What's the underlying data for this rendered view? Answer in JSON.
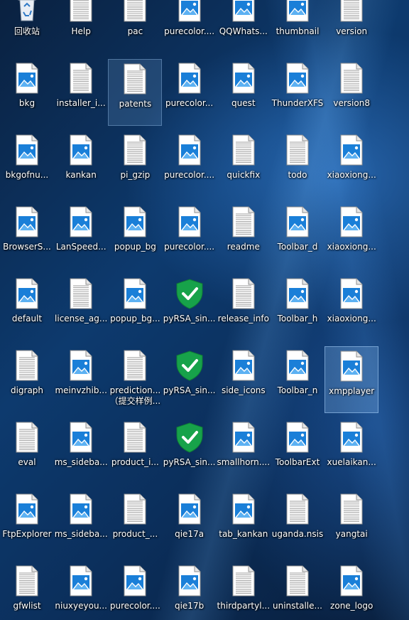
{
  "desktop": {
    "icons": [
      {
        "label": "回收站",
        "type": "recycle-bin"
      },
      {
        "label": "Help",
        "type": "document"
      },
      {
        "label": "pac",
        "type": "document"
      },
      {
        "label": "purecolor....",
        "type": "image"
      },
      {
        "label": "QQWhats...",
        "type": "image"
      },
      {
        "label": "thumbnail",
        "type": "image"
      },
      {
        "label": "version",
        "type": "document"
      },
      {
        "label": "bkg",
        "type": "image"
      },
      {
        "label": "installer_i...",
        "type": "document"
      },
      {
        "label": "patents",
        "type": "document",
        "state": "hovered"
      },
      {
        "label": "purecolor...",
        "type": "image"
      },
      {
        "label": "quest",
        "type": "image"
      },
      {
        "label": "ThunderXFS",
        "type": "image"
      },
      {
        "label": "version8",
        "type": "document"
      },
      {
        "label": "bkgofnu...",
        "type": "image"
      },
      {
        "label": "kankan",
        "type": "image"
      },
      {
        "label": "pi_gzip",
        "type": "document"
      },
      {
        "label": "purecolor....",
        "type": "image"
      },
      {
        "label": "quickfix",
        "type": "document"
      },
      {
        "label": "todo",
        "type": "document"
      },
      {
        "label": "xiaoxiong...",
        "type": "image"
      },
      {
        "label": "BrowserS...",
        "type": "image"
      },
      {
        "label": "LanSpeed...",
        "type": "image"
      },
      {
        "label": "popup_bg",
        "type": "image"
      },
      {
        "label": "purecolor....",
        "type": "image"
      },
      {
        "label": "readme",
        "type": "document"
      },
      {
        "label": "Toolbar_d",
        "type": "image"
      },
      {
        "label": "xiaoxiong...",
        "type": "image"
      },
      {
        "label": "default",
        "type": "image"
      },
      {
        "label": "license_ag...",
        "type": "document"
      },
      {
        "label": "popup_bg...",
        "type": "image"
      },
      {
        "label": "pyRSA_sin...",
        "type": "shield"
      },
      {
        "label": "release_info",
        "type": "document"
      },
      {
        "label": "Toolbar_h",
        "type": "image"
      },
      {
        "label": "xiaoxiong...",
        "type": "image"
      },
      {
        "label": "digraph",
        "type": "document"
      },
      {
        "label": "meinvzhib...",
        "type": "image"
      },
      {
        "label": "prediction...\n（提交样例...",
        "type": "document"
      },
      {
        "label": "pyRSA_sin...",
        "type": "shield"
      },
      {
        "label": "side_icons",
        "type": "image"
      },
      {
        "label": "Toolbar_n",
        "type": "image"
      },
      {
        "label": "xmpplayer",
        "type": "image",
        "state": "selected"
      },
      {
        "label": "eval",
        "type": "document"
      },
      {
        "label": "ms_sideba...",
        "type": "image"
      },
      {
        "label": "product_i...",
        "type": "document"
      },
      {
        "label": "pyRSA_sin...",
        "type": "shield"
      },
      {
        "label": "smallhorn....",
        "type": "image"
      },
      {
        "label": "ToolbarExt",
        "type": "image"
      },
      {
        "label": "xuelaikan...",
        "type": "image"
      },
      {
        "label": "FtpExplorer",
        "type": "image"
      },
      {
        "label": "ms_sideba...",
        "type": "image"
      },
      {
        "label": "product_...",
        "type": "document"
      },
      {
        "label": "qie17a",
        "type": "image"
      },
      {
        "label": "tab_kankan",
        "type": "image"
      },
      {
        "label": "uganda.nsis",
        "type": "document"
      },
      {
        "label": "yangtai",
        "type": "document"
      },
      {
        "label": "gfwlist",
        "type": "document"
      },
      {
        "label": "niuxyeyou...",
        "type": "image"
      },
      {
        "label": "purecolor....",
        "type": "image"
      },
      {
        "label": "qie17b",
        "type": "image"
      },
      {
        "label": "thirdpartyl...",
        "type": "document"
      },
      {
        "label": "uninstalle...",
        "type": "document"
      },
      {
        "label": "zone_logo",
        "type": "image"
      }
    ]
  },
  "colors": {
    "image_blue": "#1a7fd8",
    "shield_green": "#17a24a",
    "doc_line": "#9a9a9a"
  }
}
